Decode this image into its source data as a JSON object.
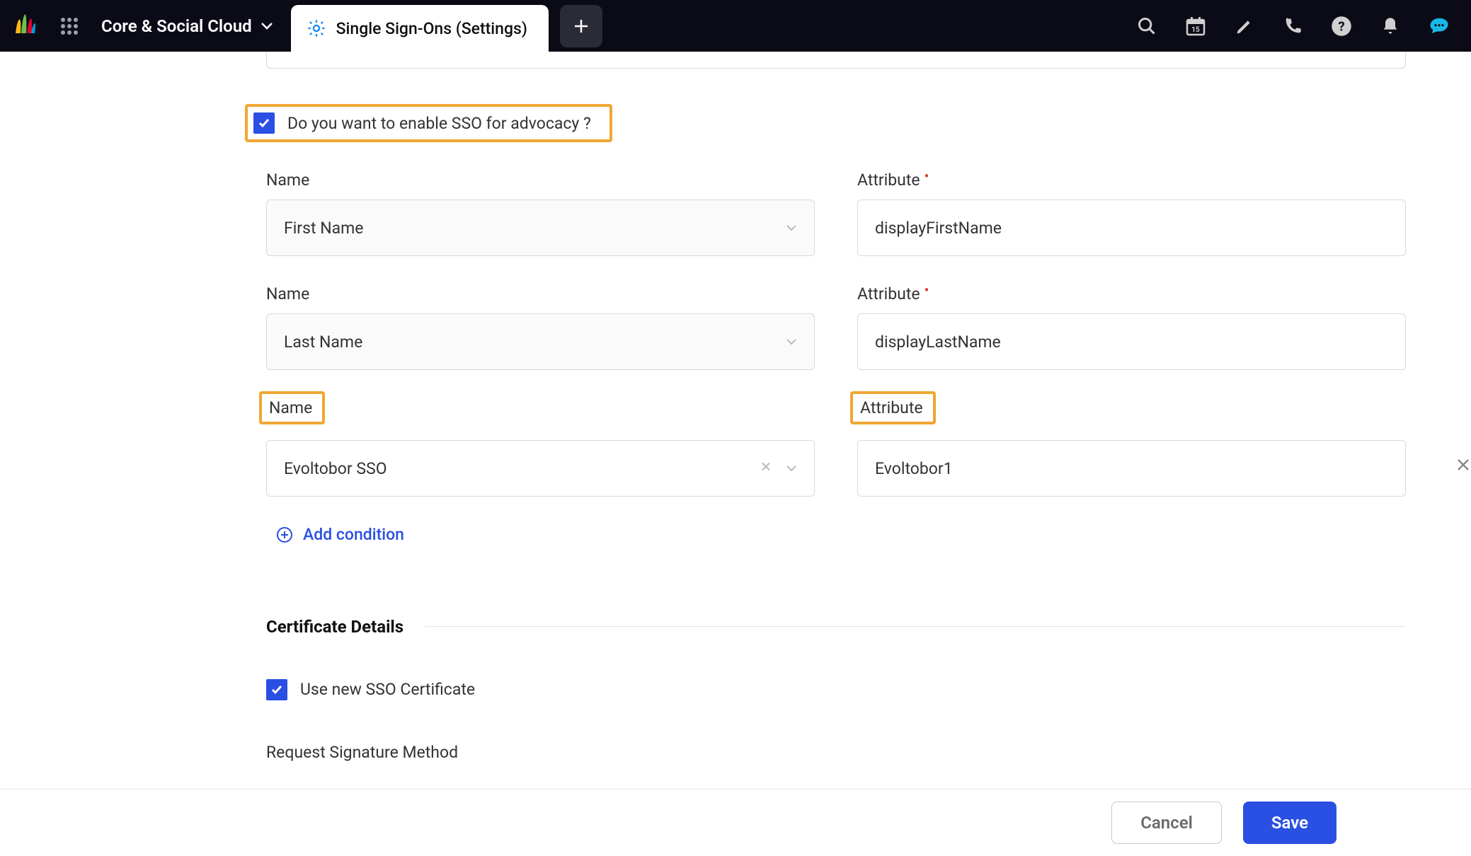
{
  "topbar": {
    "workspace_label": "Core & Social Cloud",
    "tab_label": "Single Sign-Ons (Settings)",
    "calendar_day": "15"
  },
  "form": {
    "advocacy_checkbox_label": "Do you want to enable SSO for advocacy ?",
    "name_label": "Name",
    "attribute_label": "Attribute",
    "rows": [
      {
        "name_value": "First Name",
        "attr_value": "displayFirstName"
      },
      {
        "name_value": "Last Name",
        "attr_value": "displayLastName"
      },
      {
        "name_value": "Evoltobor SSO",
        "attr_value": "Evoltobor1"
      }
    ],
    "add_condition_label": "Add condition",
    "cert_section_title": "Certificate Details",
    "use_new_cert_label": "Use new SSO Certificate",
    "request_sig_label": "Request Signature Method"
  },
  "footer": {
    "cancel_label": "Cancel",
    "save_label": "Save"
  }
}
